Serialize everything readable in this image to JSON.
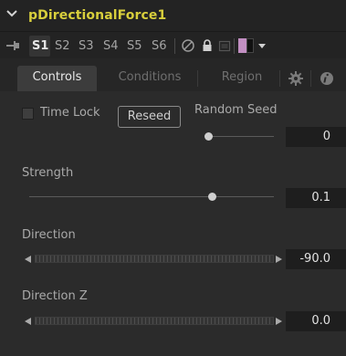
{
  "tool": {
    "name": "pDirectionalForce1"
  },
  "slots": [
    "S1",
    "S2",
    "S3",
    "S4",
    "S5",
    "S6"
  ],
  "tabs": [
    "Controls",
    "Conditions",
    "Region"
  ],
  "controls": {
    "time_lock": {
      "label": "Time Lock",
      "checked": false
    },
    "reseed_label": "Reseed",
    "random_seed": {
      "label": "Random Seed",
      "value": "0",
      "position": 0.0
    },
    "strength": {
      "label": "Strength",
      "value": "0.1",
      "position": 0.6
    },
    "direction": {
      "label": "Direction",
      "value": "-90.0"
    },
    "direction_z": {
      "label": "Direction Z",
      "value": "0.0"
    }
  },
  "colors": {
    "title": "#d8cf3c",
    "swatch_pink": "#c28fc2",
    "swatch_black": "#111111"
  },
  "icons": [
    "chevron-down-icon",
    "pin-icon",
    "disable-icon",
    "lock-icon",
    "cache-icon",
    "dropdown-arrow-icon",
    "gear-icon",
    "info-icon"
  ]
}
